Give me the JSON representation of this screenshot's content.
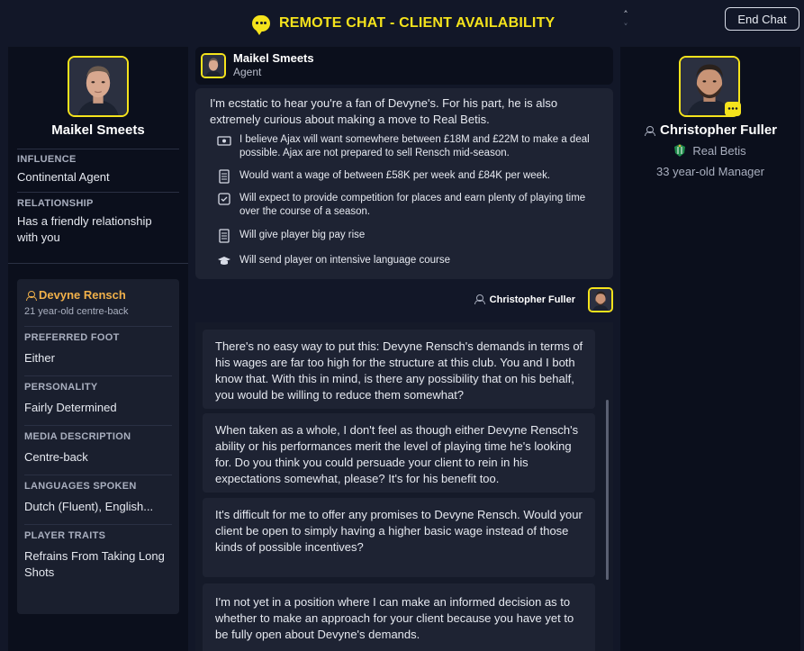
{
  "header": {
    "title": "REMOTE CHAT - CLIENT AVAILABILITY",
    "end_chat_label": "End Chat",
    "up_arrow": "˄",
    "down_arrow": "˅"
  },
  "colors": {
    "accent_yellow": "#f5e31c",
    "player_name_orange": "#f0b04a",
    "panel_dark": "#0b0f1c",
    "bubble": "#1e2333"
  },
  "left_panel": {
    "agent_name": "Maikel Smeets",
    "influence_label": "INFLUENCE",
    "influence_value": "Continental Agent",
    "relationship_label": "RELATIONSHIP",
    "relationship_value": "Has a friendly relationship with you",
    "player": {
      "name": "Devyne Rensch",
      "subtitle": "21 year-old centre-back",
      "fields": [
        {
          "label": "PREFERRED FOOT",
          "value": "Either"
        },
        {
          "label": "PERSONALITY",
          "value": "Fairly Determined"
        },
        {
          "label": "MEDIA DESCRIPTION",
          "value": "Centre-back"
        },
        {
          "label": "LANGUAGES SPOKEN",
          "value": "Dutch (Fluent), English..."
        },
        {
          "label": "PLAYER TRAITS",
          "value": "Refrains From Taking Long Shots"
        }
      ]
    }
  },
  "center": {
    "agent_header": {
      "name": "Maikel Smeets",
      "role": "Agent"
    },
    "agent_message": {
      "intro": "I'm ecstatic to hear you're a fan of Devyne's. For his part, he is also extremely curious about making a move to Real Betis.",
      "items": [
        {
          "icon": "money-icon",
          "text": "I believe Ajax will want somewhere between £18M and £22M to make a deal possible. Ajax are not prepared to sell Rensch mid-season."
        },
        {
          "icon": "contract-icon",
          "text": "Would want a wage of between £58K per week and £84K per week."
        },
        {
          "icon": "playing-time-icon",
          "text": "Will expect to provide competition for places and earn plenty of playing time over the course of a season."
        },
        {
          "icon": "contract-icon",
          "text": "Will give player big pay rise"
        },
        {
          "icon": "graduation-cap-icon",
          "text": "Will send player on intensive language course"
        }
      ]
    },
    "me_label": "Christopher Fuller",
    "thread": [
      "There's no easy way to put this: Devyne Rensch's demands in terms of his wages are far too high for the structure at this club. You and I both know that. With this in mind, is there any possibility that on his behalf, you would be willing to reduce them somewhat?",
      "When taken as a whole, I don't feel as though either Devyne Rensch's ability or his performances merit the level of playing time he's looking for. Do you think you could persuade your client to rein in his expectations somewhat, please? It's for his benefit too.",
      "It's difficult for me to offer any promises to Devyne Rensch. Would your client be open to simply having a higher basic wage instead of those kinds of possible incentives?",
      "I'm not yet in a position where I can make an informed decision as to whether to make an approach for your client because you have yet to be fully open about Devyne's demands."
    ]
  },
  "right_panel": {
    "name": "Christopher Fuller",
    "club": "Real Betis",
    "role": "33 year-old Manager"
  }
}
